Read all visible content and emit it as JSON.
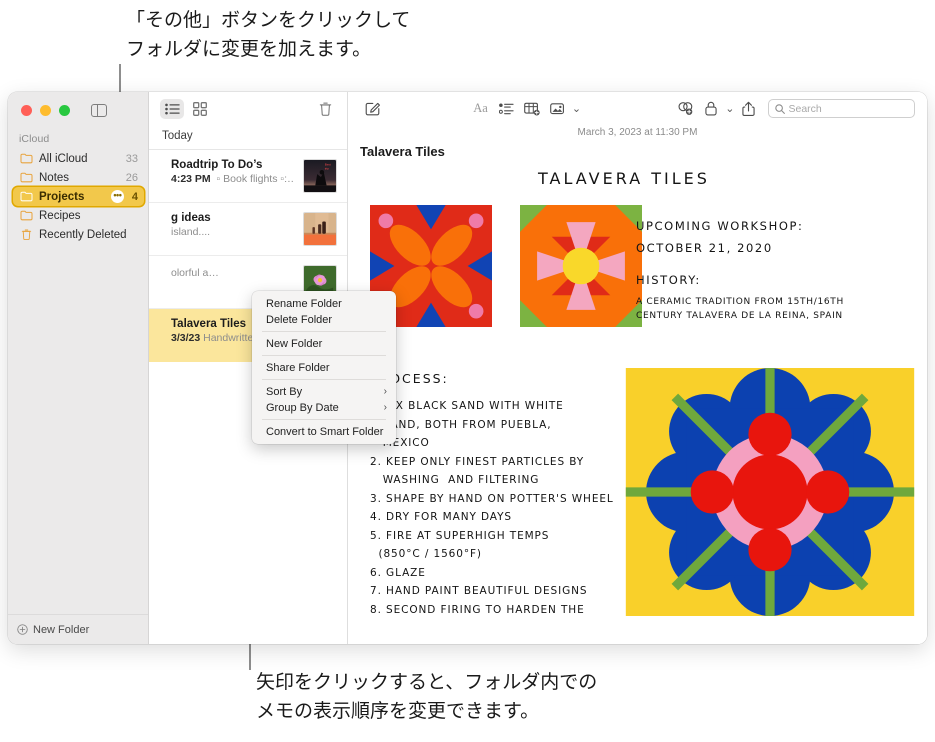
{
  "callouts": {
    "top": "「その他」ボタンをクリックして\nフォルダに変更を加えます。",
    "bottom": "矢印をクリックすると、フォルダ内での\nメモの表示順序を変更できます。"
  },
  "window": {
    "traffic_lights": [
      "close",
      "minimize",
      "zoom"
    ],
    "sidebar_toggle_label": "sidebar-toggle"
  },
  "sidebar": {
    "section_label": "iCloud",
    "items": [
      {
        "label": "All iCloud",
        "count": "33",
        "icon": "folder-icon",
        "selected": false
      },
      {
        "label": "Notes",
        "count": "26",
        "icon": "folder-icon",
        "selected": false
      },
      {
        "label": "Projects",
        "count": "4",
        "icon": "folder-icon",
        "selected": true,
        "more": "•••"
      },
      {
        "label": "Recipes",
        "count": "",
        "icon": "folder-icon",
        "selected": false
      },
      {
        "label": "Recently Deleted",
        "count": "",
        "icon": "trash-icon",
        "selected": false
      }
    ],
    "new_folder_label": "New Folder",
    "accent_yellow": "#f2c84b",
    "accent_border": "#e0a800"
  },
  "context_menu": {
    "groups": [
      [
        {
          "label": "Rename Folder",
          "submenu": false
        },
        {
          "label": "Delete Folder",
          "submenu": false
        }
      ],
      [
        {
          "label": "New Folder",
          "submenu": false
        }
      ],
      [
        {
          "label": "Share Folder",
          "submenu": false
        }
      ],
      [
        {
          "label": "Sort By",
          "submenu": true,
          "chevron": "›"
        },
        {
          "label": "Group By Date",
          "submenu": true,
          "chevron": "›"
        }
      ],
      [
        {
          "label": "Convert to Smart Folder",
          "submenu": false
        }
      ]
    ]
  },
  "note_list": {
    "toolbar": {
      "list_view": "list-view-icon",
      "gallery_view": "gallery-view-icon",
      "delete": "trash-icon",
      "active_view": "list"
    },
    "group_header": "Today",
    "notes": [
      {
        "title": "Roadtrip To Do’s",
        "time": "4:23 PM",
        "preview": "Book flights",
        "preview_tail": ":…",
        "selected": false,
        "thumb": "roadtrip-photo"
      },
      {
        "title": "g ideas",
        "time": "",
        "preview": "island....",
        "preview_tail": "",
        "selected": false,
        "thumb": "interior-photo"
      },
      {
        "title": "",
        "time": "",
        "preview": "olorful a…",
        "preview_tail": "",
        "selected": false,
        "thumb": "flower-photo"
      },
      {
        "title": "Talavera Tiles",
        "time": "3/3/23",
        "preview": "Handwritten note",
        "preview_tail": "",
        "selected": true,
        "thumb": "tiles-sketch"
      }
    ]
  },
  "editor": {
    "toolbar": {
      "compose": "compose-icon",
      "format": "Aa",
      "checklist": "checklist-icon",
      "table": "table-icon",
      "media": "media-icon",
      "media_chevron": "⌄",
      "collaborate": "collaborate-icon",
      "lock": "lock-icon",
      "lock_chevron": "⌄",
      "share": "share-icon"
    },
    "search": {
      "placeholder": "Search",
      "icon": "search-icon",
      "value": ""
    },
    "date": "March 3, 2023 at 11:30 PM",
    "title": "Talavera Tiles",
    "handwriting": {
      "title": "TALAVERA TILES",
      "workshop": "UPCOMING WORKSHOP:\nOCTOBER 21, 2020",
      "history_heading": "HISTORY:",
      "history_body": "A CERAMIC TRADITION FROM 15TH/16TH\nCENTURY TALAVERA DE LA REINA, SPAIN",
      "process_heading": "PROCESS:",
      "process_body": "1 MIX BLACK SAND WITH WHITE\n   SAND, BOTH FROM PUEBLA,\n   MEXICO\n2. KEEP ONLY FINEST PARTICLES BY\n   WASHING  AND FILTERING\n3. SHAPE BY HAND ON POTTER'S WHEEL\n4. DRY FOR MANY DAYS\n5. FIRE AT SUPERHIGH TEMPS\n  (850°C / 1560°F)\n6. GLAZE\n7. HAND PAINT BEAUTIFUL DESIGNS\n8. SECOND FIRING TO HARDEN THE"
    },
    "artwork": {
      "tile_left": {
        "name": "butterfly-tile",
        "bg": "#e02b18",
        "petal": "#f97009",
        "corner_dot": "#ef7ba8",
        "triangle": "#1144b4"
      },
      "tile_right": {
        "name": "starburst-tile",
        "bg": "#f97009",
        "green": "#7cb342",
        "red": "#e02b18",
        "pink": "#f4a7c0",
        "center": "#f9d82a"
      },
      "flower": {
        "name": "flower-tile",
        "bg": "#f9d02a",
        "blue": "#0c41b0",
        "green": "#6fa83c",
        "pink": "#f4a0c0",
        "red": "#e8150d"
      }
    }
  }
}
